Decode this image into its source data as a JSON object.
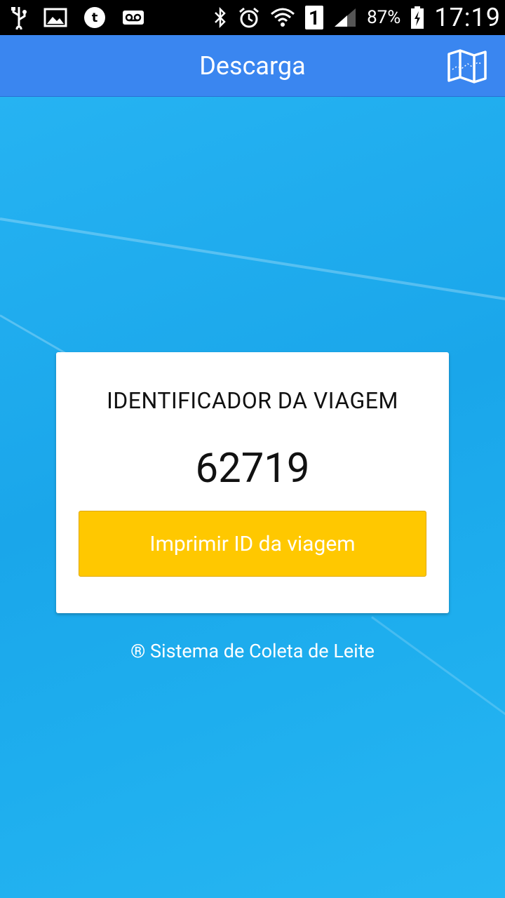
{
  "status_bar": {
    "battery_percent": "87%",
    "time": "17:19",
    "sim_label": "1",
    "icons_left": [
      "usb-icon",
      "image-icon",
      "t-app-icon",
      "voicemail-icon"
    ],
    "icons_right": [
      "bluetooth-icon",
      "alarm-icon",
      "wifi-icon",
      "sim-icon",
      "signal-icon",
      "battery-icon"
    ]
  },
  "app_bar": {
    "title": "Descarga",
    "action_icon": "map-icon"
  },
  "card": {
    "title": "IDENTIFICADOR DA VIAGEM",
    "trip_id": "62719",
    "print_button_label": "Imprimir ID da viagem"
  },
  "footer": {
    "text": "® Sistema de Coleta de Leite"
  },
  "colors": {
    "app_bar": "#3a86f0",
    "background": "#1ea9ec",
    "button": "#ffc800",
    "card": "#ffffff"
  }
}
